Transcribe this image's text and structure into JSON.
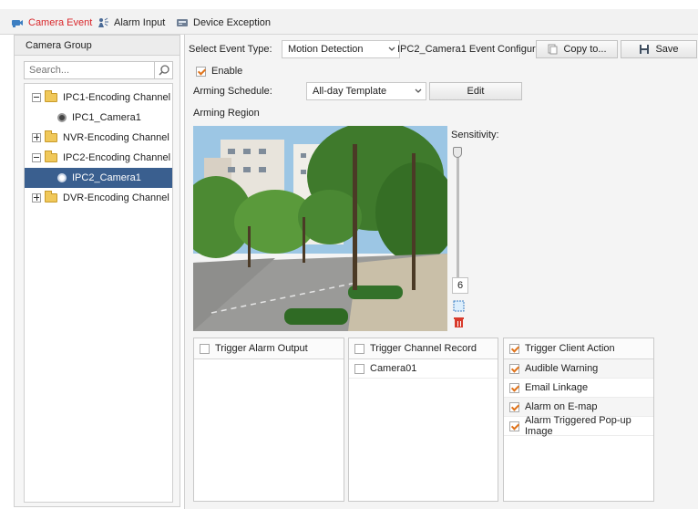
{
  "tabs": [
    {
      "label": "Camera Event",
      "icon": "camera-icon",
      "active": true
    },
    {
      "label": "Alarm Input",
      "icon": "alarm-input-icon",
      "active": false
    },
    {
      "label": "Device Exception",
      "icon": "device-exception-icon",
      "active": false
    }
  ],
  "left": {
    "header": "Camera Group",
    "search_placeholder": "Search...",
    "tree": [
      {
        "label": "IPC1-Encoding Channel",
        "type": "group",
        "expanded": true
      },
      {
        "label": "IPC1_Camera1",
        "type": "camera",
        "selected": false
      },
      {
        "label": "NVR-Encoding Channel",
        "type": "group",
        "expanded": false
      },
      {
        "label": "IPC2-Encoding Channel",
        "type": "group",
        "expanded": true
      },
      {
        "label": "IPC2_Camera1",
        "type": "camera",
        "selected": true
      },
      {
        "label": "DVR-Encoding Channel",
        "type": "group",
        "expanded": false
      }
    ]
  },
  "main": {
    "event_type_label": "Select Event Type:",
    "event_type_value": "Motion Detection",
    "config_title": "IPC2_Camera1 Event Configur...",
    "copy_label": "Copy to...",
    "save_label": "Save",
    "enable_label": "Enable",
    "enable_checked": true,
    "schedule_label": "Arming Schedule:",
    "schedule_value": "All-day Template",
    "edit_label": "Edit",
    "region_label": "Arming Region",
    "sensitivity_label": "Sensitivity:",
    "sensitivity_value": "6",
    "panels": {
      "alarm_output": {
        "label": "Trigger Alarm Output",
        "checked": false
      },
      "channel_record": {
        "label": "Trigger Channel Record",
        "checked": false,
        "items": [
          {
            "label": "Camera01",
            "checked": false
          }
        ]
      },
      "client_action": {
        "label": "Trigger Client Action",
        "checked": true,
        "items": [
          {
            "label": "Audible Warning",
            "checked": true
          },
          {
            "label": "Email Linkage",
            "checked": true
          },
          {
            "label": "Alarm on E-map",
            "checked": true
          },
          {
            "label": "Alarm Triggered Pop-up Image",
            "checked": true
          }
        ]
      }
    }
  },
  "colors": {
    "active_tab": "#d9262a",
    "selection": "#3a5f8f",
    "check": "#e0741c"
  }
}
